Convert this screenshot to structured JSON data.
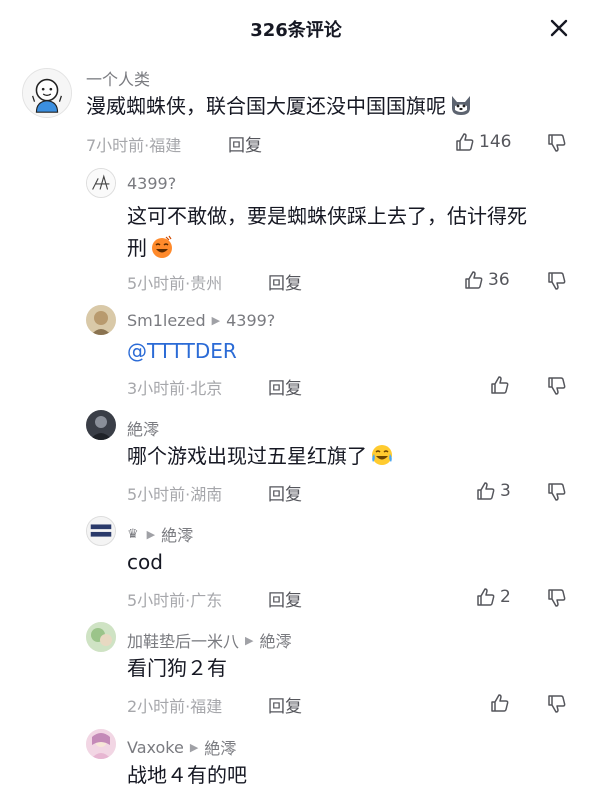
{
  "header": {
    "title": "326条评论"
  },
  "comments": [
    {
      "author": "一个人类",
      "text": "漫威蜘蛛侠，联合国大厦还没中国国旗呢",
      "emoji": "dog-emoji",
      "time_location": "7小时前·福建",
      "reply_label": "回复",
      "likes": "146"
    },
    {
      "author": "4399?",
      "text_line1": "这可不敢做，要是蜘蛛侠踩上去了，估计得死",
      "text_line2": "刑",
      "emoji": "laughing-crying-emoji",
      "time_location": "5小时前·贵州",
      "reply_label": "回复",
      "likes": "36"
    },
    {
      "author": "Sm1lezed",
      "reply_to": "4399?",
      "text": "@TTTTDER",
      "time_location": "3小时前·北京",
      "reply_label": "回复"
    },
    {
      "author": "絶澪",
      "text": "哪个游戏出现过五星红旗了",
      "emoji": "crying-laughing-emoji",
      "time_location": "5小时前·湖南",
      "reply_label": "回复",
      "likes": "3"
    },
    {
      "author": "♛",
      "reply_to": "絶澪",
      "text": "cod",
      "time_location": "5小时前·广东",
      "reply_label": "回复",
      "likes": "2"
    },
    {
      "author": "加鞋垫后一米八",
      "reply_to": "絶澪",
      "text": "看门狗２有",
      "time_location": "2小时前·福建",
      "reply_label": "回复"
    },
    {
      "author": "Vaxoke",
      "reply_to": "絶澪",
      "text": "战地４有的吧"
    }
  ],
  "colors": {
    "text_primary": "#161823",
    "text_secondary": "#7a7b80",
    "meta": "#a6a7ab",
    "mention": "#2b6bd6"
  }
}
